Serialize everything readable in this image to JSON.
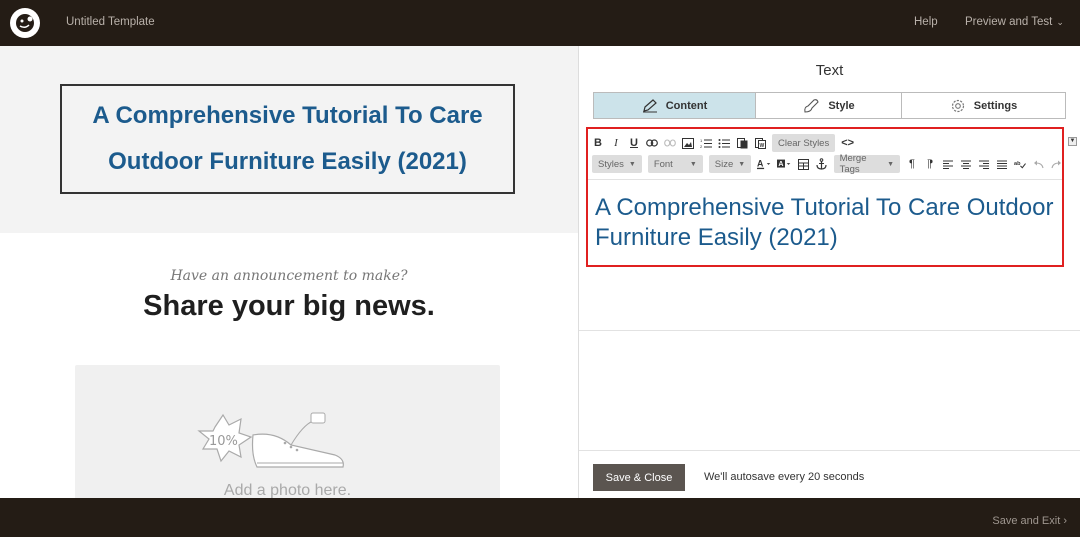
{
  "header": {
    "app_title": "Untitled Template",
    "help_label": "Help",
    "preview_label": "Preview and Test",
    "preview_chevron": "⌄"
  },
  "canvas": {
    "hero_text": "A Comprehensive Tutorial To Care Outdoor Furniture Easily (2021)",
    "announcement": "Have an announcement to make?",
    "headline": "Share your big news.",
    "photo_placeholder": "Add a photo here.",
    "photo_badge": "10%"
  },
  "panel": {
    "title": "Text",
    "tabs": [
      {
        "label": "Content",
        "icon": "pencil-icon",
        "active": true
      },
      {
        "label": "Style",
        "icon": "brush-icon",
        "active": false
      },
      {
        "label": "Settings",
        "icon": "gear-icon",
        "active": false
      }
    ],
    "toolbar": {
      "bold": "B",
      "italic": "I",
      "underline": "U",
      "clear_styles": "Clear Styles",
      "source": "<>",
      "styles": "Styles",
      "font": "Font",
      "size": "Size",
      "merge_tags": "Merge Tags"
    },
    "editor_text": "A Comprehensive Tutorial To Care Outdoor Furniture Easily (2021)",
    "save_close_label": "Save & Close",
    "autosave_text": "We'll autosave every 20 seconds"
  },
  "footer": {
    "save_exit_label": "Save and Exit",
    "save_exit_chevron": "›"
  },
  "colors": {
    "topbar": "#241c15",
    "accent_text": "#1c5b8d",
    "active_tab": "#cce3ea",
    "editor_border": "#e02020",
    "save_button": "#5b5550"
  }
}
